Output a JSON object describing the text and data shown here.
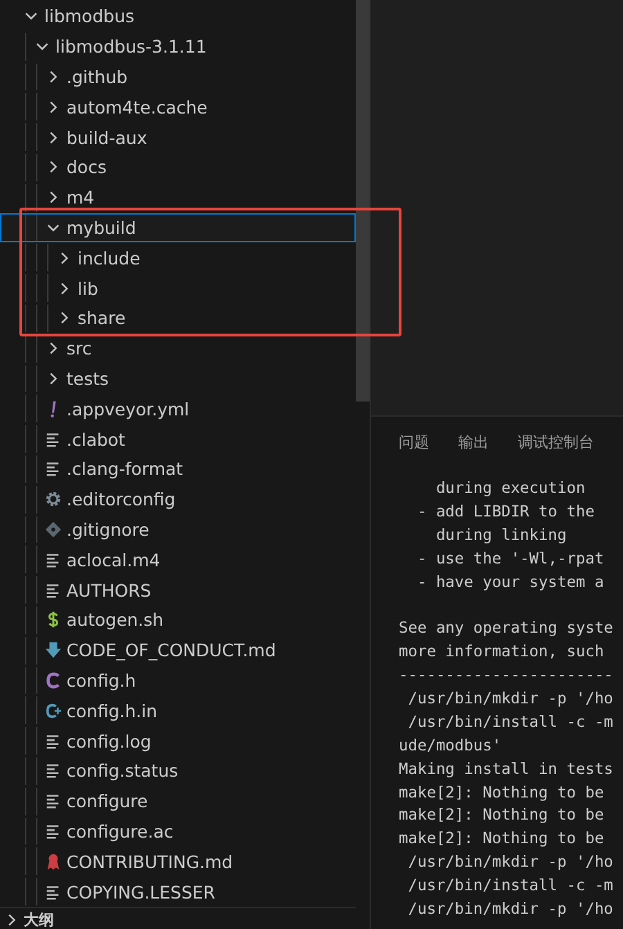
{
  "explorer": {
    "tree": [
      {
        "name": "libmodbus",
        "kind": "folder",
        "expanded": true,
        "selected": false,
        "children": [
          {
            "name": "libmodbus-3.1.11",
            "kind": "folder",
            "expanded": true,
            "selected": false,
            "children": [
              {
                "name": ".github",
                "kind": "folder",
                "expanded": false,
                "selected": false
              },
              {
                "name": "autom4te.cache",
                "kind": "folder",
                "expanded": false,
                "selected": false
              },
              {
                "name": "build-aux",
                "kind": "folder",
                "expanded": false,
                "selected": false
              },
              {
                "name": "docs",
                "kind": "folder",
                "expanded": false,
                "selected": false
              },
              {
                "name": "m4",
                "kind": "folder",
                "expanded": false,
                "selected": false
              },
              {
                "name": "mybuild",
                "kind": "folder",
                "expanded": true,
                "selected": true,
                "children": [
                  {
                    "name": "include",
                    "kind": "folder",
                    "expanded": false,
                    "selected": false
                  },
                  {
                    "name": "lib",
                    "kind": "folder",
                    "expanded": false,
                    "selected": false
                  },
                  {
                    "name": "share",
                    "kind": "folder",
                    "expanded": false,
                    "selected": false
                  }
                ]
              },
              {
                "name": "src",
                "kind": "folder",
                "expanded": false,
                "selected": false
              },
              {
                "name": "tests",
                "kind": "folder",
                "expanded": false,
                "selected": false
              },
              {
                "name": ".appveyor.yml",
                "kind": "yaml",
                "selected": false
              },
              {
                "name": ".clabot",
                "kind": "text",
                "selected": false
              },
              {
                "name": ".clang-format",
                "kind": "text",
                "selected": false
              },
              {
                "name": ".editorconfig",
                "kind": "gear",
                "selected": false
              },
              {
                "name": ".gitignore",
                "kind": "git",
                "selected": false
              },
              {
                "name": "aclocal.m4",
                "kind": "text",
                "selected": false
              },
              {
                "name": "AUTHORS",
                "kind": "text",
                "selected": false
              },
              {
                "name": "autogen.sh",
                "kind": "shell",
                "selected": false
              },
              {
                "name": "CODE_OF_CONDUCT.md",
                "kind": "download",
                "selected": false
              },
              {
                "name": "config.h",
                "kind": "c",
                "selected": false
              },
              {
                "name": "config.h.in",
                "kind": "cin",
                "selected": false
              },
              {
                "name": "config.log",
                "kind": "text",
                "selected": false
              },
              {
                "name": "config.status",
                "kind": "text",
                "selected": false
              },
              {
                "name": "configure",
                "kind": "text",
                "selected": false
              },
              {
                "name": "configure.ac",
                "kind": "text",
                "selected": false
              },
              {
                "name": "CONTRIBUTING.md",
                "kind": "ribbon",
                "selected": false
              },
              {
                "name": "COPYING.LESSER",
                "kind": "text",
                "selected": false
              }
            ]
          }
        ]
      }
    ],
    "outline_section": {
      "title": "大纲",
      "expanded": false
    }
  },
  "panel": {
    "tabs": [
      {
        "label": "问题",
        "selected": false
      },
      {
        "label": "输出",
        "selected": false
      },
      {
        "label": "调试控制台",
        "selected": false
      }
    ],
    "terminal_blocks": [
      [
        "    during execution",
        "  - add LIBDIR to the",
        "    during linking",
        "  - use the '-Wl,-rpat",
        "  - have your system a"
      ],
      [
        "See any operating syste",
        "more information, such",
        "-----------------------",
        " /usr/bin/mkdir -p '/ho",
        " /usr/bin/install -c -m",
        "ude/modbus'",
        "Making install in tests",
        "make[2]: Nothing to be",
        "make[2]: Nothing to be",
        "make[2]: Nothing to be",
        " /usr/bin/mkdir -p '/ho",
        " /usr/bin/install -c -m",
        " /usr/bin/mkdir -p '/ho"
      ]
    ]
  }
}
